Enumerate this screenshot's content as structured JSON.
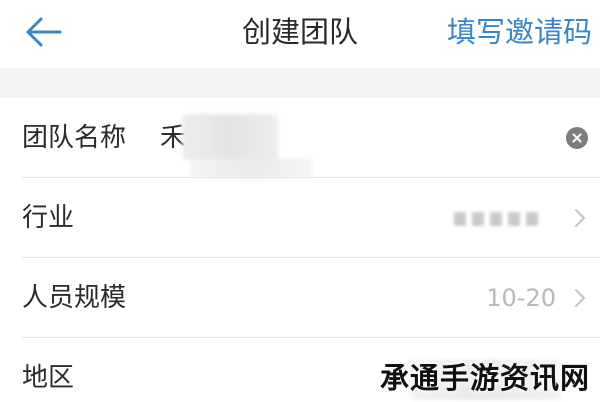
{
  "header": {
    "back_icon": "arrow-left-icon",
    "title": "创建团队",
    "action_label": "填写邀请码",
    "accent_color": "#3a86c8"
  },
  "form": {
    "team_name": {
      "label": "团队名称",
      "value": "禾",
      "clear_icon": "clear-circle-icon"
    },
    "industry": {
      "label": "行业",
      "value": "",
      "chevron_icon": "chevron-right-icon"
    },
    "team_size": {
      "label": "人员规模",
      "value": "10-20",
      "chevron_icon": "chevron-right-icon"
    },
    "region": {
      "label": "地区",
      "value": ""
    }
  },
  "watermark": {
    "text": "承通手游资讯网"
  }
}
